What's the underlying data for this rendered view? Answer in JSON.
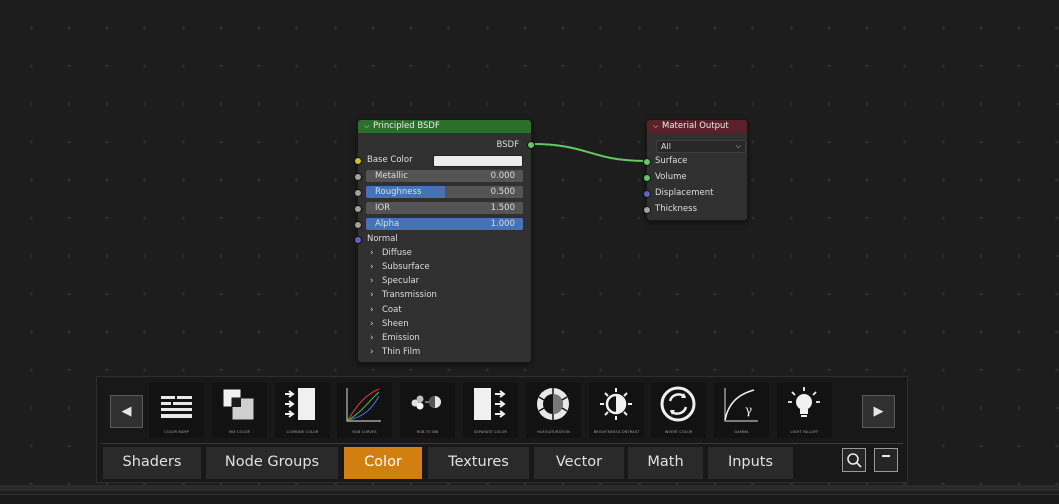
{
  "bsdf_node": {
    "title": "Principled BSDF",
    "output_label": "BSDF",
    "base_color_label": "Base Color",
    "base_color_value": "#ececec",
    "fields": [
      {
        "label": "Metallic",
        "value": "0.000",
        "fill": 0.0
      },
      {
        "label": "Roughness",
        "value": "0.500",
        "fill": 0.5
      },
      {
        "label": "IOR",
        "value": "1.500",
        "fill": 0.0
      },
      {
        "label": "Alpha",
        "value": "1.000",
        "fill": 1.0
      }
    ],
    "normal_label": "Normal",
    "panels": [
      "Diffuse",
      "Subsurface",
      "Specular",
      "Transmission",
      "Coat",
      "Sheen",
      "Emission",
      "Thin Film"
    ]
  },
  "output_node": {
    "title": "Material Output",
    "target": "All",
    "inputs": [
      "Surface",
      "Volume",
      "Displacement",
      "Thickness"
    ]
  },
  "toolbar": {
    "prev_glyph": "◀",
    "next_glyph": "▶",
    "icons": [
      {
        "icon": "color-ramp-icon",
        "caption": "Color Ramp"
      },
      {
        "icon": "mix-color-icon",
        "caption": "Mix Color"
      },
      {
        "icon": "combine-color-icon",
        "caption": "Combine Color"
      },
      {
        "icon": "rgb-curves-icon",
        "caption": "RGB Curves"
      },
      {
        "icon": "rgb-to-bw-icon",
        "caption": "RGB to BW"
      },
      {
        "icon": "separate-color-icon",
        "caption": "Separate Color"
      },
      {
        "icon": "hue-saturation-icon",
        "caption": "Hue/Saturation"
      },
      {
        "icon": "brightness-contrast-icon",
        "caption": "Brightness/Contrast"
      },
      {
        "icon": "invert-color-icon",
        "caption": "Invert Color"
      },
      {
        "icon": "gamma-icon",
        "caption": "Gamma"
      },
      {
        "icon": "light-falloff-icon",
        "caption": "Light Falloff"
      }
    ],
    "tabs": [
      "Shaders",
      "Node Groups",
      "Color",
      "Textures",
      "Vector",
      "Math",
      "Inputs"
    ],
    "active_tab": "Color"
  },
  "colors": {
    "bsdf_header": "#2c6e2c",
    "output_header": "#5a2228",
    "active_tab": "#d17f10",
    "field_fill": "#4772b3",
    "wire": "#63c763"
  }
}
